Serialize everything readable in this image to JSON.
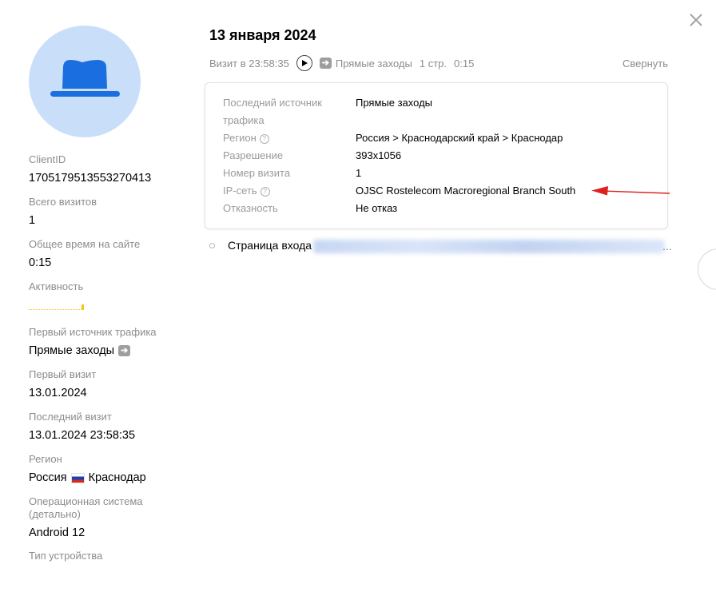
{
  "header": {
    "date_title": "13 января 2024"
  },
  "visit_bar": {
    "visit_time": "Визит в 23:58:35",
    "source": "Прямые заходы",
    "pages": "1 стр.",
    "duration": "0:15",
    "collapse": "Свернуть"
  },
  "visit_details": [
    {
      "label": "Последний источник трафика",
      "value": "Прямые заходы",
      "help": false
    },
    {
      "label": "Регион",
      "value": "Россия > Краснодарский край > Краснодар",
      "help": true
    },
    {
      "label": "Разрешение",
      "value": "393x1056",
      "help": false
    },
    {
      "label": "Номер визита",
      "value": "1",
      "help": false
    },
    {
      "label": "IP-сеть",
      "value": "OJSC Rostelecom Macroregional Branch South",
      "help": true
    },
    {
      "label": "Отказность",
      "value": "Не отказ",
      "help": false
    }
  ],
  "entry_page": {
    "label": "Страница входа"
  },
  "profile": {
    "client_id_label": "ClientID",
    "client_id": "1705179513553270413",
    "total_visits_label": "Всего визитов",
    "total_visits": "1",
    "total_time_label": "Общее время на сайте",
    "total_time": "0:15",
    "activity_label": "Активность",
    "first_source_label": "Первый источник трафика",
    "first_source": "Прямые заходы",
    "first_visit_label": "Первый визит",
    "first_visit": "13.01.2024",
    "last_visit_label": "Последний визит",
    "last_visit": "13.01.2024 23:58:35",
    "region_label": "Регион",
    "region_country": "Россия",
    "region_city": "Краснодар",
    "os_label": "Операционная система (детально)",
    "os": "Android 12",
    "device_label": "Тип устройства"
  },
  "colors": {
    "avatar_bg": "#c9dff9",
    "hat": "#1b6ee0",
    "annotation_arrow": "#e0201c",
    "activity": "#f5c518"
  },
  "icons": [
    "close-icon",
    "hat-icon",
    "play-icon",
    "arrow-right-icon",
    "help-icon",
    "russia-flag-icon",
    "chevron-right-icon"
  ]
}
